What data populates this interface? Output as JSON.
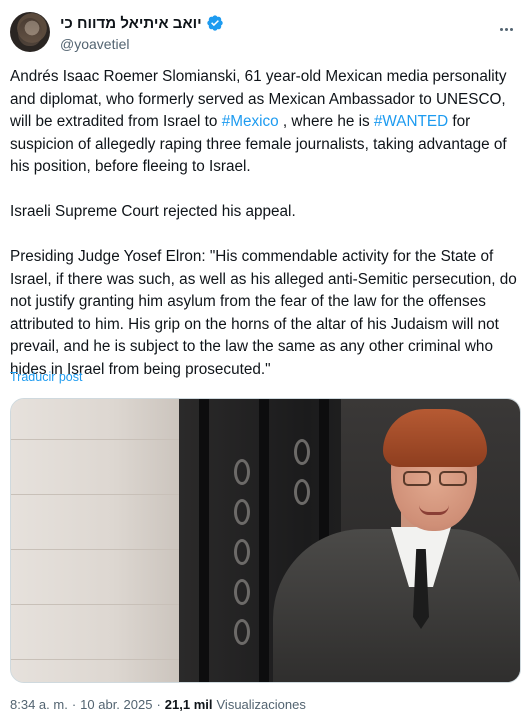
{
  "author": {
    "display_name": "יואב איתיאל מדווח כי",
    "handle": "@yoavetiel"
  },
  "post": {
    "segments": [
      {
        "text": "Andrés Isaac Roemer Slomianski, 61 year-old Mexican media personality and diplomat, who formerly served as Mexican Ambassador to UNESCO, will be extradited from Israel to ",
        "type": "text"
      },
      {
        "text": "#Mexico",
        "type": "hashtag"
      },
      {
        "text": " , where he is ",
        "type": "text"
      },
      {
        "text": "#WANTED",
        "type": "hashtag"
      },
      {
        "text": "  for suspicion of allegedly raping three female journalists, taking advantage of his position, before fleeing to Israel.\n\nIsraeli Supreme Court rejected his appeal.\n\nPresiding Judge Yosef Elron: \"His commendable activity for the State of Israel, if there was such, as well as his alleged anti-Semitic persecution, do not justify granting him asylum from the fear of the law for the offenses attributed to him. His grip on the horns of the altar of his Judaism will not prevail, and he is subject to the law the same as any other criminal who hides in Israel from being prosecuted.\"",
        "type": "text"
      }
    ],
    "translate_label": "Traducir post"
  },
  "meta": {
    "time": "8:34 a. m.",
    "separator": "·",
    "date": "10 abr. 2025",
    "views_count": "21,1 mil",
    "views_label": "Visualizaciones"
  },
  "colors": {
    "accent": "#1d9bf0",
    "text": "#0f1419",
    "secondary": "#536471"
  }
}
